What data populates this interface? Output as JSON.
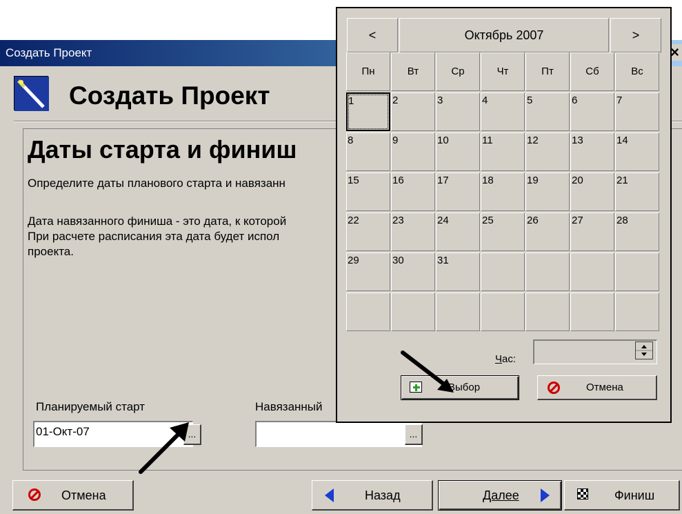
{
  "window": {
    "title": "Создать Проект",
    "close_glyph": "×"
  },
  "header": {
    "title": "Создать Проект",
    "icon": "magic-wand-icon"
  },
  "section": {
    "title": "Даты старта и финиш",
    "description_1": "Определите даты планового старта и навязанн",
    "description_2_line1": "Дата навязанного финиша - это дата, к которой",
    "description_2_line2": "При расчете расписания эта дата будет испол",
    "description_2_line3": "проекта."
  },
  "fields": {
    "start_label": "Планируемый старт",
    "start_value": "01-Окт-07",
    "finish_label": "Навязанный",
    "finish_value": "",
    "ellipsis": "..."
  },
  "buttons": {
    "cancel": "Отмена",
    "back": "Назад",
    "next": "Далее",
    "finish": "Финиш"
  },
  "calendar": {
    "prev": "<",
    "next": ">",
    "month_label": "Октябрь 2007",
    "weekdays": [
      "Пн",
      "Вт",
      "Ср",
      "Чт",
      "Пт",
      "Сб",
      "Вс"
    ],
    "weeks": [
      [
        "1",
        "2",
        "3",
        "4",
        "5",
        "6",
        "7"
      ],
      [
        "8",
        "9",
        "10",
        "11",
        "12",
        "13",
        "14"
      ],
      [
        "15",
        "16",
        "17",
        "18",
        "19",
        "20",
        "21"
      ],
      [
        "22",
        "23",
        "24",
        "25",
        "26",
        "27",
        "28"
      ],
      [
        "29",
        "30",
        "31",
        "",
        "",
        "",
        ""
      ],
      [
        "",
        "",
        "",
        "",
        "",
        "",
        ""
      ]
    ],
    "selected_day": "1",
    "hour_label_underlined": "Ч",
    "hour_label_rest": "ас:",
    "hour_value": "",
    "select_button": "Выбор",
    "cancel_button": "Отмена"
  }
}
